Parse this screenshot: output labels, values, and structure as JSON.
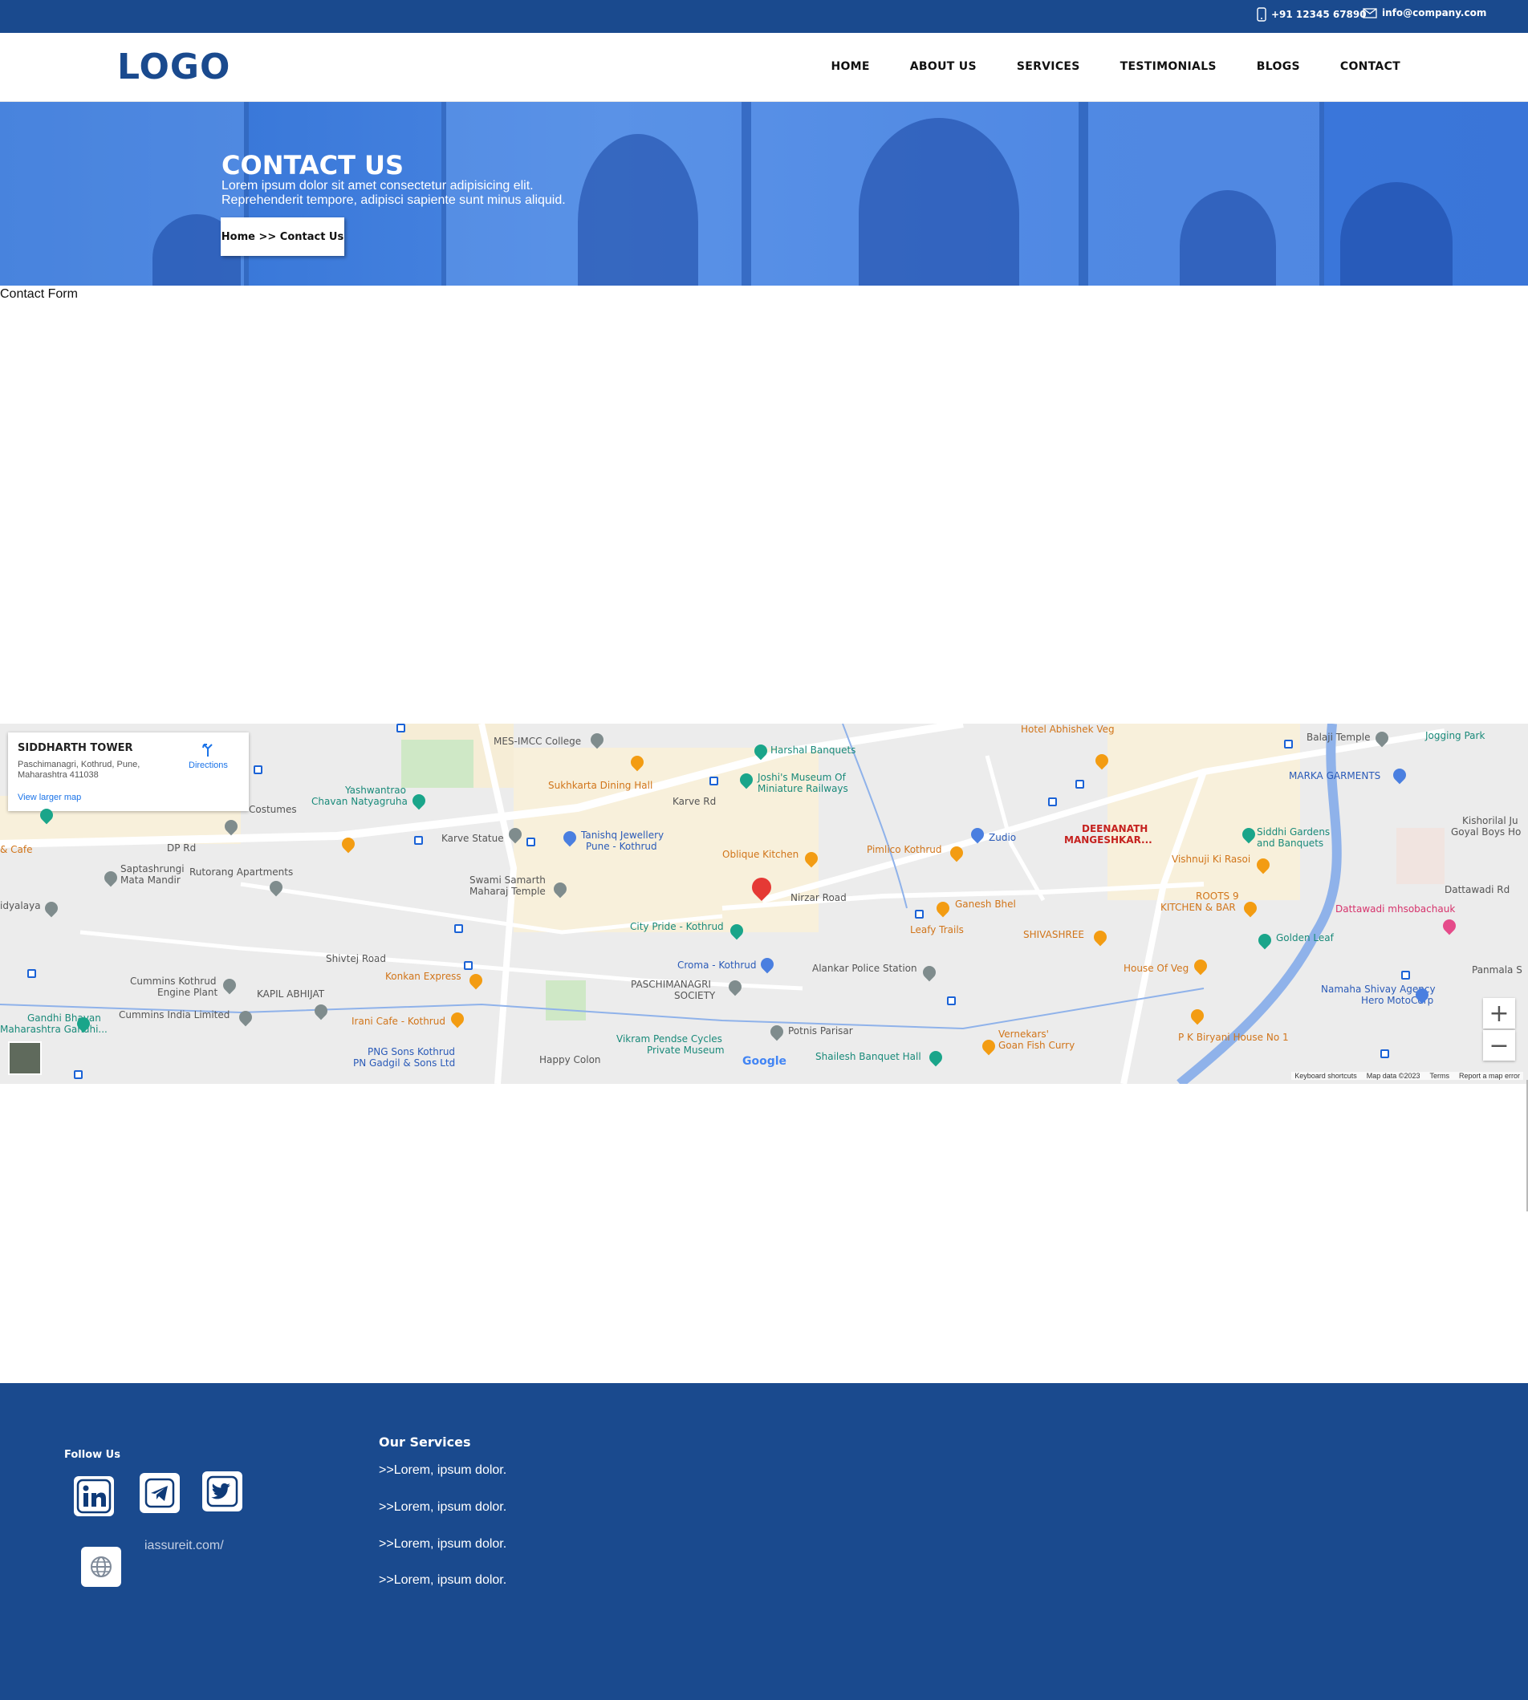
{
  "topbar": {
    "phone": "+91 12345 67890",
    "email": "info@company.com",
    "phone_icon": "phone-icon",
    "email_icon": "mail-icon"
  },
  "header": {
    "logo": "LOGO",
    "nav": [
      "HOME",
      "ABOUT US",
      "SERVICES",
      "TESTIMONIALS",
      "BLOGS",
      "CONTACT"
    ]
  },
  "hero": {
    "title": "CONTACT US",
    "line1": "Lorem ipsum dolor sit amet consectetur adipisicing elit.",
    "line2": "Reprehenderit tempore, adipisci sapiente sunt minus aliquid.",
    "breadcrumb": "Home >> Contact Us"
  },
  "contact_form_label": "Contact Form",
  "map": {
    "place": {
      "name": "SIDDHARTH TOWER",
      "address1": "Paschimanagri, Kothrud, Pune,",
      "address2": "Maharashtra 411038",
      "directions": "Directions",
      "view_larger": "View larger map"
    },
    "labels": [
      "MES-IMCC College",
      "Harshal Banquets",
      "Joshi's Museum Of",
      "Miniature Railways",
      "Sukhkarta Dining Hall",
      "Yashwantrao",
      "Chavan Natyagruha",
      "Karve Statue",
      "Tanishq Jewellery",
      "Pune - Kothrud",
      "Swami Samarth",
      "Maharaj Temple",
      "Oblique Kitchen",
      "Pimlico Kothrud",
      "Zudio",
      "Hotel Abhishek Veg",
      "Balaji Temple",
      "Jogging Park",
      "MARKA GARMENTS",
      "DEENANATH",
      "MANGESHKAR...",
      "Siddhi Gardens",
      "and Banquets",
      "Vishnuji Ki Rasoi",
      "ROOTS 9",
      "KITCHEN & BAR",
      "Dattawadi mhsobachauk",
      "Golden Leaf",
      "Kishorilal Ju",
      "Goyal Boys Ho",
      "Ganesh Bhel",
      "Leafy Trails",
      "SHIVASHREE",
      "House Of Veg",
      "City Pride - Kothrud",
      "Croma - Kothrud",
      "Alankar Police Station",
      "PASCHIMANAGRI",
      "SOCIETY",
      "Konkan Express",
      "Irani Cafe - Kothrud",
      "Cummins Kothrud",
      "Engine Plant",
      "Cummins India Limited",
      "KAPIL ABHIJAT",
      "Gandhi Bhavan",
      "Maharashtra Gandhi...",
      "PNG Sons Kothrud",
      "PN Gadgil & Sons Ltd",
      "Vikram Pendse Cycles",
      "Private Museum",
      "Potnis Parisar",
      "Shailesh Banquet Hall",
      "Vernekars'",
      "Goan Fish Curry",
      "P K Biryani House No 1",
      "Namaha Shivay Agency",
      "Hero MotoCorp",
      "Panmala S",
      "Saptashrungi",
      "Mata Mandir",
      "Rutorang Apartments",
      "Nirzar Road",
      "Karve Rd",
      "DP Rd",
      "Shivtej Road",
      "Happy Colon",
      "Dattawadi Rd",
      "Costumes",
      "& Cafe",
      "idyalaya"
    ],
    "zoom_in": "+",
    "zoom_out": "−",
    "google": "Google",
    "attribution": [
      "Keyboard shortcuts",
      "Map data ©2023",
      "Terms",
      "Report a map error"
    ]
  },
  "footer": {
    "follow": "Follow Us",
    "social_icons": [
      "linkedin-icon",
      "telegram-icon",
      "twitter-icon",
      "globe-icon"
    ],
    "site": "iassureit.com/",
    "services_title": "Our Services",
    "services": [
      ">>Lorem, ipsum dolor.",
      ">>Lorem, ipsum dolor.",
      ">>Lorem, ipsum dolor.",
      ">>Lorem, ipsum dolor."
    ]
  },
  "colors": {
    "brand": "#1a4a8e",
    "hero": "#3b78dc"
  }
}
